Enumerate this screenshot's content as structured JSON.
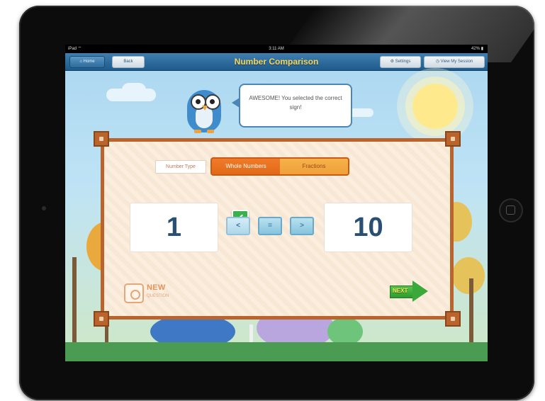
{
  "statusbar": {
    "carrier": "iPad ⌔",
    "time": "3:11 AM",
    "battery": "42% ▮"
  },
  "navbar": {
    "home_label": "Home",
    "back_label": "Back",
    "title": "Number Comparison",
    "settings_label": "Settings",
    "view_session_label": "View My Session"
  },
  "feedback": {
    "message": "AWESOME! You selected the correct sign!"
  },
  "board": {
    "number_type_label": "Number Type",
    "type_options": [
      {
        "label": "Whole Numbers",
        "selected": true
      },
      {
        "label": "Fractions",
        "selected": false
      }
    ],
    "left_number": "1",
    "right_number": "10",
    "signs": [
      "<",
      "=",
      ">"
    ],
    "selected_sign": "<",
    "correct_indicator": "✔",
    "new_question_label": "NEW",
    "new_question_sublabel": "QUESTION",
    "next_label": "NEXT"
  },
  "colors": {
    "nav_bg": "#2b679a",
    "title_yellow": "#f6d75a",
    "board_border": "#b8642c",
    "toggle_orange": "#e06a18",
    "number_blue": "#2a4f74",
    "next_green": "#3aa93a"
  }
}
